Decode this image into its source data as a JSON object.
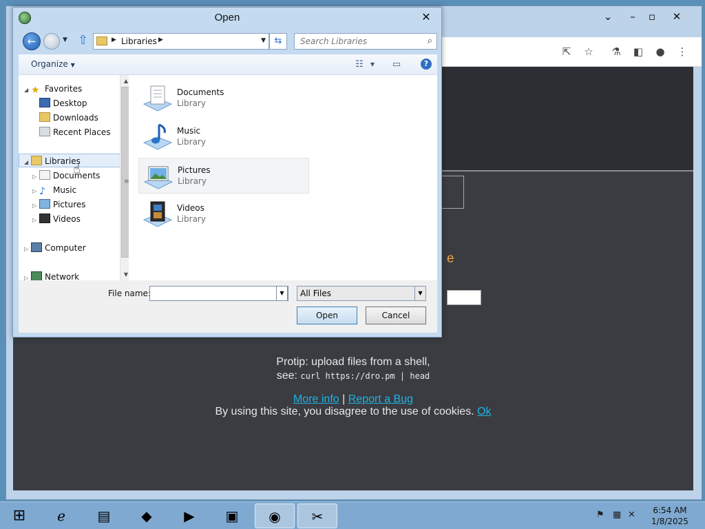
{
  "dialog": {
    "title": "Open",
    "breadcrumb": "Libraries",
    "search_placeholder": "Search Libraries",
    "organize_label": "Organize",
    "file_name_label": "File name:",
    "file_name_value": "",
    "file_type_selected": "All Files",
    "open_button": "Open",
    "cancel_button": "Cancel",
    "tree": {
      "favorites": "Favorites",
      "desktop": "Desktop",
      "downloads": "Downloads",
      "recent_places": "Recent Places",
      "libraries": "Libraries",
      "documents": "Documents",
      "music": "Music",
      "pictures": "Pictures",
      "videos": "Videos",
      "computer": "Computer",
      "network": "Network"
    },
    "items": [
      {
        "name": "Documents",
        "type": "Library"
      },
      {
        "name": "Music",
        "type": "Library"
      },
      {
        "name": "Pictures",
        "type": "Library"
      },
      {
        "name": "Videos",
        "type": "Library"
      }
    ]
  },
  "webpage": {
    "orange_fragment": "e",
    "protip_line1": "Protip: upload files from a shell,",
    "protip_see": "see:",
    "protip_command": "curl https://dro.pm | head",
    "more_info": "More info",
    "separator": "|",
    "report_bug": "Report a Bug",
    "cookie_text": "By using this site, you disagree to the use of cookies.",
    "cookie_ok": "Ok"
  },
  "taskbar": {
    "time": "6:54 AM",
    "date": "1/8/2025"
  },
  "colors": {
    "page_bg": "#3a3c41",
    "link": "#1fb3e6",
    "accent_orange": "#f0a346"
  }
}
